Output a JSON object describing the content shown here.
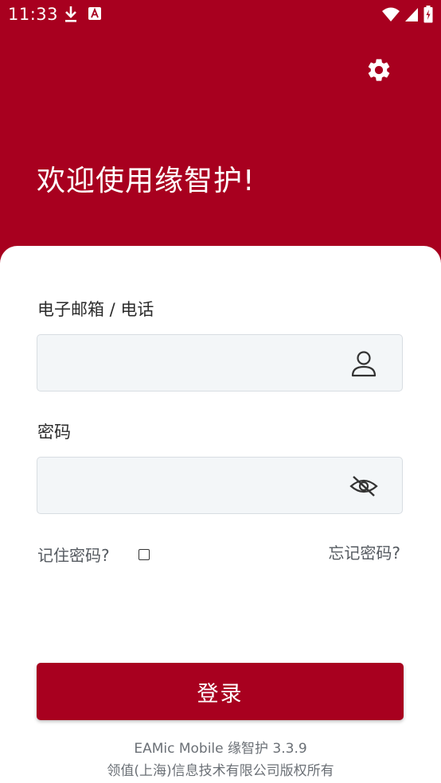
{
  "status_bar": {
    "time": "11:33",
    "left_icons": [
      "download-icon",
      "app-notification-icon"
    ],
    "right_icons": [
      "wifi-icon",
      "signal-icon",
      "battery-charging-icon"
    ]
  },
  "header": {
    "settings_icon": "gear-icon",
    "welcome_text": "欢迎使用缘智护!"
  },
  "form": {
    "account_label": "电子邮箱 / 电话",
    "account_value": "",
    "account_icon": "user-icon",
    "password_label": "密码",
    "password_value": "",
    "password_icon": "eye-off-icon",
    "remember_label": "记住密码?",
    "remember_checked": false,
    "forgot_label": "忘记密码?",
    "login_label": "登录"
  },
  "footer": {
    "version": "EAMic Mobile 缘智护 3.3.9",
    "copyright": "领值(上海)信息技术有限公司版权所有"
  },
  "colors": {
    "brand": "#a8001f",
    "input_bg": "#f3f6f8",
    "text_muted": "#6b7076"
  }
}
